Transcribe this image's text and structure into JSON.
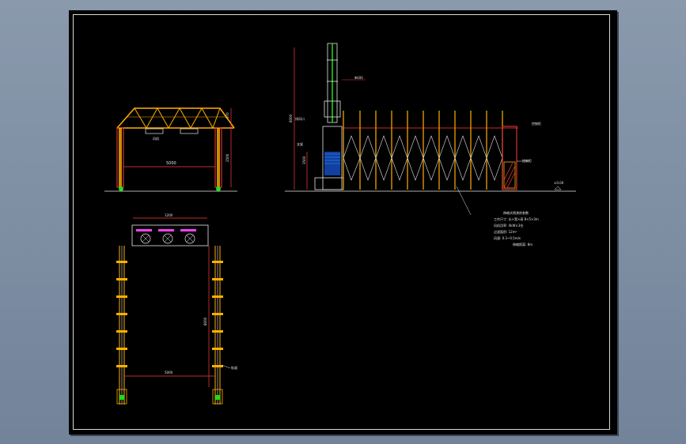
{
  "dimensions": {
    "front_overall_height": "3000",
    "front_inner_height": "2500",
    "front_top": "370",
    "front_width": "5000",
    "side_total_height": "6000",
    "side_chimney": "Φ400",
    "side_lower": "3500",
    "plan_top": "1200",
    "plan_length": "8000",
    "plan_width": "5000"
  },
  "labels": {
    "front_fan": "风机",
    "side_note_1": "排风口",
    "side_note_2": "支架",
    "side_note_3": "控制柜",
    "ground": "±0.00",
    "plan_rail": "轨道"
  },
  "notes": [
    "伸缩式喷漆房参数",
    "工作尺寸: 长×宽×高 8×5×3m",
    "风机功率: 4kW×3台",
    "过滤面积: 12m²",
    "风速: 0.3~0.5m/s",
    "伸缩距离: 8m"
  ],
  "colors": {
    "frame": "#ffb000",
    "red": "#ff3b3b",
    "green": "#19e019",
    "blue": "#3aa0ff",
    "magenta": "#ff40ff",
    "white": "#e6e6e6"
  }
}
